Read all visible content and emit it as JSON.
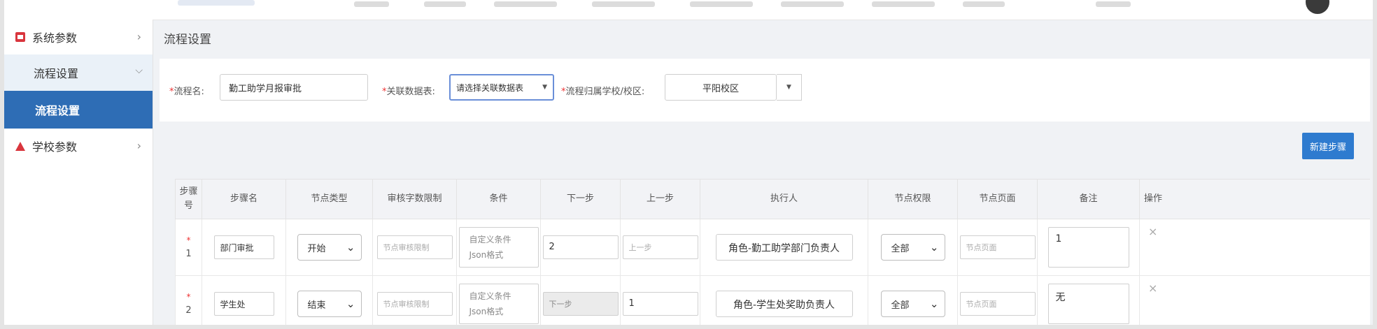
{
  "sidebar": {
    "items": [
      {
        "label": "系统参数",
        "icon": "settings-red-icon"
      },
      {
        "label": "流程设置"
      },
      {
        "label": "流程设置"
      },
      {
        "label": "学校参数",
        "icon": "warning-triangle-icon"
      }
    ]
  },
  "page": {
    "title": "流程设置"
  },
  "form": {
    "name_label": "流程名:",
    "name_value": "勤工助学月报审批",
    "table_label": "关联数据表:",
    "table_select": "请选择关联数据表",
    "campus_label": "流程归属学校/校区:",
    "campus_value": "平阳校区"
  },
  "toolbar": {
    "new_step_label": "新建步骤"
  },
  "table": {
    "headers": [
      "步骤号",
      "步骤名",
      "节点类型",
      "审核字数限制",
      "条件",
      "下一步",
      "上一步",
      "执行人",
      "节点权限",
      "节点页面",
      "备注",
      "操作"
    ],
    "rows": [
      {
        "no": "1",
        "step_name": "部门审批",
        "node_type": "开始",
        "limit_placeholder": "节点审核限制",
        "condition": "自定义条件Json格式",
        "next": "2",
        "prev_placeholder": "上一步",
        "executor": "角色-勤工助学部门负责人",
        "permission": "全部",
        "page_placeholder": "节点页面",
        "note": "1",
        "action": "×"
      },
      {
        "no": "2",
        "step_name": "学生处",
        "node_type": "结束",
        "limit_placeholder": "节点审核限制",
        "condition": "自定义条件Json格式",
        "next_placeholder": "下一步",
        "prev": "1",
        "executor": "角色-学生处奖助负责人",
        "permission": "全部",
        "page_placeholder": "节点页面",
        "note": "无",
        "action": "×"
      }
    ]
  },
  "colors": {
    "primary": "#2e6db5",
    "button": "#2e7bcf",
    "required": "#e33333"
  }
}
